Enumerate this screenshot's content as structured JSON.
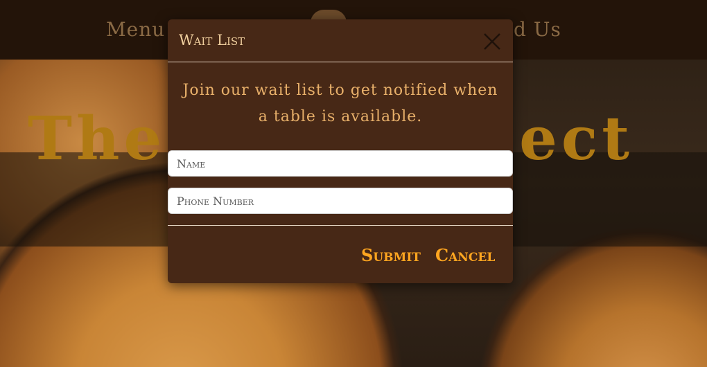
{
  "nav": {
    "menu_label": "Menu",
    "find_label": "nd Us"
  },
  "hero": {
    "title_left": "The",
    "title_right": "ject"
  },
  "modal": {
    "title": "Wait List",
    "close_icon": "close-icon",
    "message": "Join our wait list to get notified when a table is available.",
    "name_field": {
      "value": "",
      "placeholder": "Name"
    },
    "phone_field": {
      "value": "",
      "placeholder": "Phone Number"
    },
    "submit_label": "Submit",
    "cancel_label": "Cancel"
  },
  "colors": {
    "modal_bg": "#472816",
    "accent": "#ffa620",
    "message_text": "#e8b06a",
    "title_text": "#f0cf9e",
    "hero_title": "#b07a14"
  }
}
